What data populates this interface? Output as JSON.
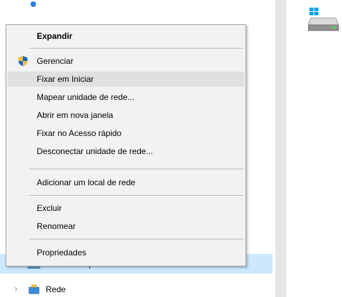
{
  "nav": {
    "selected_item_label": "p",
    "rede_label": "Rede"
  },
  "menu": {
    "items": [
      {
        "label": "Expandir",
        "bold": true
      },
      {
        "label": "Gerenciar",
        "icon": "shield-icon"
      },
      {
        "label": "Fixar em Iniciar",
        "highlighted": true
      },
      {
        "label": "Mapear unidade de rede..."
      },
      {
        "label": "Abrir em nova janela"
      },
      {
        "label": "Fixar no Acesso rápido"
      },
      {
        "label": "Desconectar unidade de rede..."
      },
      {
        "label": "Adicionar um local de rede"
      },
      {
        "label": "Excluir"
      },
      {
        "label": "Renomear"
      },
      {
        "label": "Propriedades"
      }
    ]
  },
  "colors": {
    "menu_bg": "#f2f2f2",
    "hover_bg": "#e0e0e0",
    "selection_bg": "#cce8ff",
    "separator": "#b8b8b8"
  }
}
